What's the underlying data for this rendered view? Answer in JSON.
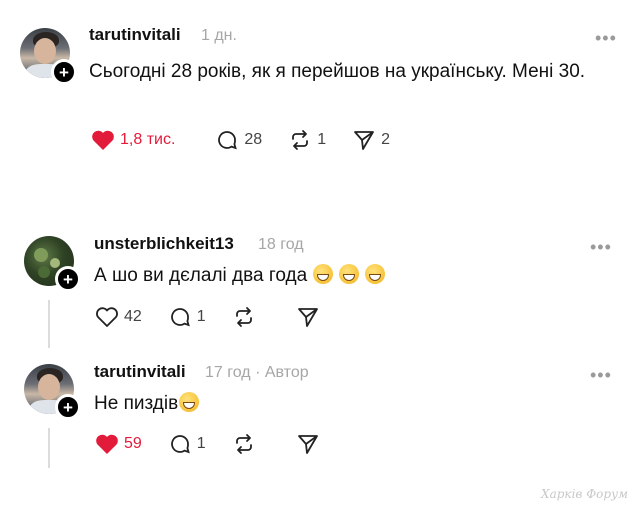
{
  "post": {
    "username": "tarutinvitali",
    "time": "1 дн.",
    "text": "Сьогодні 28 років, як я перейшов на українську. Мені 30.",
    "likes": "1,8 тис.",
    "comments": "28",
    "reposts": "1",
    "shares": "2",
    "liked": true
  },
  "reply1": {
    "username": "unsterblichkeit13",
    "time": "18 год",
    "text": "А шо ви дєлалі два года",
    "likes": "42",
    "comments": "1"
  },
  "reply2": {
    "username": "tarutinvitali",
    "time": "17 год",
    "author_badge": "Автор",
    "separator": "·",
    "text": "Не пиздів",
    "likes": "59",
    "comments": "1",
    "liked": true
  },
  "more_glyph": "•••",
  "watermark": "Харків Форум",
  "colors": {
    "like_red": "#e31b3b",
    "meta_gray": "#a6a6a6"
  }
}
